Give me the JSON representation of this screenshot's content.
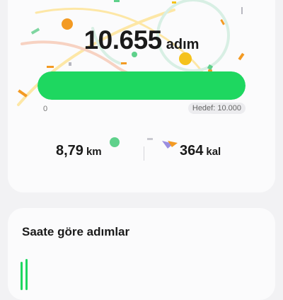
{
  "summary": {
    "steps_value": "10.655",
    "steps_unit": "adım",
    "progress_fraction": 1.0,
    "progress_color": "#1ed760",
    "scale_min": "0",
    "goal_label": "Hedef: 10.000",
    "distance_value": "8,79",
    "distance_unit": "km",
    "calories_value": "364",
    "calories_unit": "kal",
    "decoration": "confetti"
  },
  "hourly": {
    "title": "Saate göre adımlar",
    "bar_color": "#1ed760"
  }
}
